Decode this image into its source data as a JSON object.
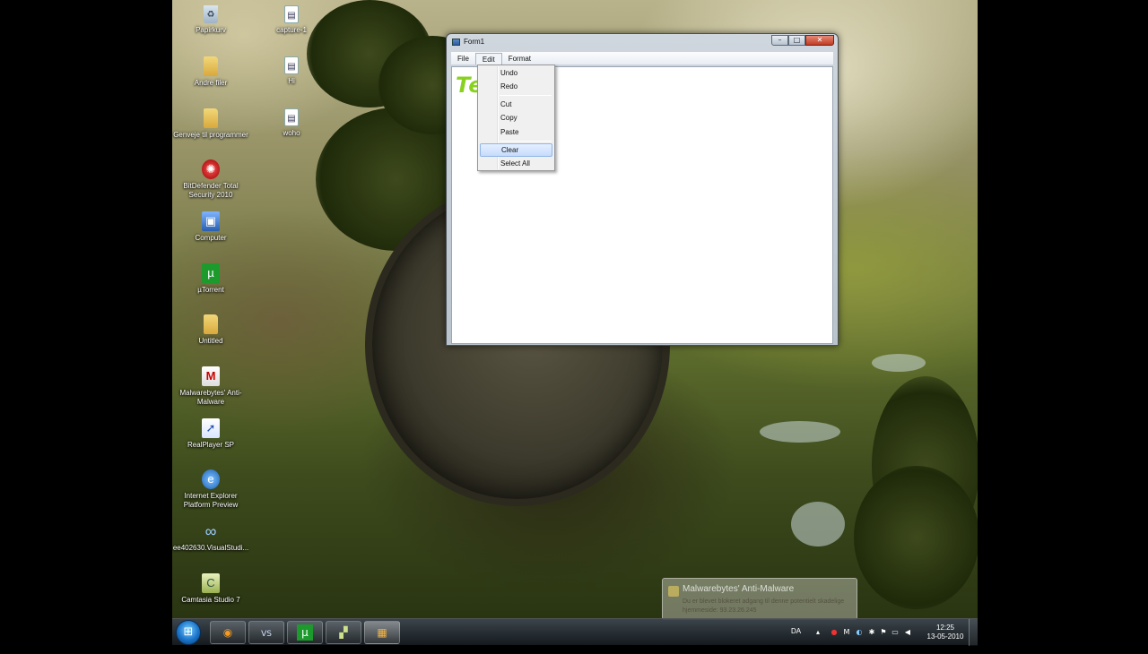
{
  "desktop": {
    "icons": [
      {
        "label": "Papirkurv",
        "icon": "recycle-bin-icon",
        "glyph": "♻"
      },
      {
        "label": "capture-1",
        "icon": "file-icon",
        "glyph": "▤"
      },
      {
        "label": "Andre filer",
        "icon": "folder-icon",
        "glyph": ""
      },
      {
        "label": "Hi",
        "icon": "file-icon",
        "glyph": "▤"
      },
      {
        "label": "Genveje til programmer",
        "icon": "folder-icon",
        "glyph": ""
      },
      {
        "label": "woho",
        "icon": "file-icon",
        "glyph": "▤"
      },
      {
        "label": "BitDefender Total Security 2010",
        "icon": "bitdefender-icon",
        "glyph": "✺"
      },
      {
        "label": "Computer",
        "icon": "computer-icon",
        "glyph": "▣"
      },
      {
        "label": "µTorrent",
        "icon": "utorrent-icon",
        "glyph": "µ"
      },
      {
        "label": "Untitled",
        "icon": "folder-icon",
        "glyph": ""
      },
      {
        "label": "Malwarebytes' Anti-Malware",
        "icon": "malwarebytes-icon",
        "glyph": "M"
      },
      {
        "label": "RealPlayer SP",
        "icon": "realplayer-icon",
        "glyph": "➚"
      },
      {
        "label": "Internet Explorer Platform Preview",
        "icon": "internet-explorer-icon",
        "glyph": "e"
      },
      {
        "label": "ee402630.VisualStudi...",
        "icon": "visual-studio-icon",
        "glyph": "∞"
      },
      {
        "label": "Camtasia Studio 7",
        "icon": "camtasia-icon",
        "glyph": "C"
      }
    ]
  },
  "window": {
    "title": "Form1",
    "caption_buttons": {
      "minimize": "–",
      "maximize": "□",
      "close": "✕"
    },
    "menus": [
      "File",
      "Edit",
      "Format"
    ],
    "content_text": "Te               t"
  },
  "edit_menu": {
    "items": [
      "Undo",
      "Redo",
      "Cut",
      "Copy",
      "Paste",
      "Clear",
      "Select All"
    ],
    "highlighted": "Clear"
  },
  "notification": {
    "title": "Malwarebytes' Anti-Malware",
    "body": "Du er blevet blokeret adgang til denne potentielt skadelige hjemmeside: 93.23.26.245"
  },
  "taskbar": {
    "start_glyph": "⊞",
    "apps": [
      {
        "name": "firefox",
        "glyph": "◉"
      },
      {
        "name": "visual-studio",
        "glyph": "VS"
      },
      {
        "name": "utorrent",
        "glyph": "µ"
      },
      {
        "name": "camtasia",
        "glyph": "▞"
      },
      {
        "name": "form1",
        "glyph": "▦"
      }
    ],
    "language": "DA",
    "time": "12:25",
    "date": "13-05-2010"
  }
}
